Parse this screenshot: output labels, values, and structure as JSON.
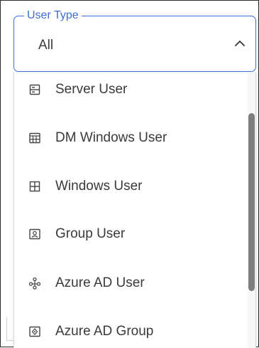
{
  "select": {
    "label": "User Type",
    "value": "All",
    "accent_color": "#3b6fd1",
    "expand_icon": "chevron-up-icon"
  },
  "options": [
    {
      "label": "Server User",
      "icon": "server-icon"
    },
    {
      "label": "DM Windows User",
      "icon": "window-grid-icon"
    },
    {
      "label": "Windows User",
      "icon": "windows-icon"
    },
    {
      "label": "Group User",
      "icon": "group-icon"
    },
    {
      "label": "Azure AD User",
      "icon": "network-nodes-icon"
    },
    {
      "label": "Azure AD Group",
      "icon": "azure-group-icon"
    }
  ]
}
